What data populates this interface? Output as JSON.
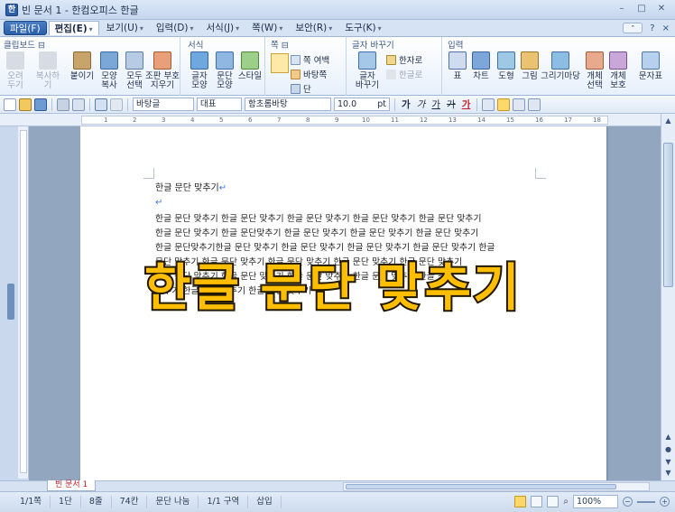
{
  "window": {
    "title": "빈 문서 1 - 한컴오피스 한글",
    "app_icon": "한",
    "minimize": "–",
    "maximize": "□",
    "close": "✕"
  },
  "menus": [
    {
      "label": "파일(F)",
      "dd": "▾"
    },
    {
      "label": "편집(E)",
      "dd": "▾"
    },
    {
      "label": "보기(U)",
      "dd": "▾"
    },
    {
      "label": "입력(D)",
      "dd": "▾"
    },
    {
      "label": "서식(J)",
      "dd": "▾"
    },
    {
      "label": "쪽(W)",
      "dd": "▾"
    },
    {
      "label": "보안(R)",
      "dd": "▾"
    },
    {
      "label": "도구(K)",
      "dd": "▾"
    }
  ],
  "menubar_right": {
    "collapse": "⌃",
    "help": "?",
    "close": "×"
  },
  "ribbon": {
    "groups": {
      "clipboard": "클립보드 ⊟",
      "format": "서식",
      "page": "쪽 ⊟",
      "charconv": "글자 바꾸기",
      "input": "입력"
    },
    "buttons": {
      "cut": "오려\n두기",
      "copy": "복사하기",
      "paste": "붙이기",
      "shape_copy": "모양\n복사",
      "select_all": "모두\n선택",
      "erase_sym": "조판 부호\n지우기",
      "char_shape": "글자\n모양",
      "para_shape": "문단\n모양",
      "style": "스타일",
      "page_margin": "쪽 여백",
      "background": "바탕쪽",
      "columns": "단",
      "hanja": "한자로",
      "hangul": "한글로",
      "char_swap": "글자\n바꾸기",
      "table": "표",
      "chart": "차트",
      "shape": "도형",
      "picture": "그림",
      "drawing": "그리기마당",
      "obj_select": "개체\n선택",
      "obj_protect": "개체\n보호",
      "text_more": "문자표"
    }
  },
  "toolbar": {
    "style_combo": "바탕글",
    "lang_combo": "대표",
    "font_combo": "함초롬바탕",
    "size_combo": "10.0",
    "size_unit": "pt",
    "bold": "가",
    "italic": "가",
    "underline": "가",
    "strike": "가",
    "color": "가"
  },
  "ruler": {
    "numbers": [
      "1",
      "2",
      "3",
      "4",
      "5",
      "6",
      "7",
      "8",
      "9",
      "10",
      "11",
      "12",
      "13",
      "14",
      "15",
      "16",
      "17",
      "18"
    ]
  },
  "document": {
    "title_line": "한글 문단 맞추기",
    "para_mark": "↵",
    "lines": [
      "한글 문단 맞추기 한글 문단 맞추기 한글 문단 맞추기 한글 문단 맞추기 한글 문단 맞추기",
      "한글 문단 맞추기 한글 문단맞추기 한글 문단 맞추기 한글 문단 맞추기 한글 문단 맞추기",
      "한글 문단맞추기한글 문단 맞추기 한글 문단 맞추기 한글 문단 맞추기 한글 문단 맞추기 한글",
      "문단 맞추기 한글 문단 맞추기 한글 문단 맞추기 한글 문단 맞추기 한글 문단 맞추기",
      "한글 문단 맞추기 한글 문단 맞추기 한글 문단 맞추기 한글 문단 맞추기 한글 문단",
      "맞추기 한글 문단 맞추기 한글 문단 맞추기"
    ]
  },
  "overlay_text": "한글 문단 맞추기",
  "tabs": {
    "doc_tab": "빈 문서 1"
  },
  "status": {
    "page": "1/1쪽",
    "column": "1단",
    "line": "8줄",
    "col_count": "74칸",
    "para_break": "문단 나눔",
    "section": "1/1 구역",
    "insert_mode": "삽입",
    "zoom": "100%"
  },
  "colors": {
    "overlay_fill": "#ffbf00",
    "overlay_stroke": "#231a00",
    "para_mark": "#3c78d8",
    "doc_tab_text": "#c0202a"
  }
}
